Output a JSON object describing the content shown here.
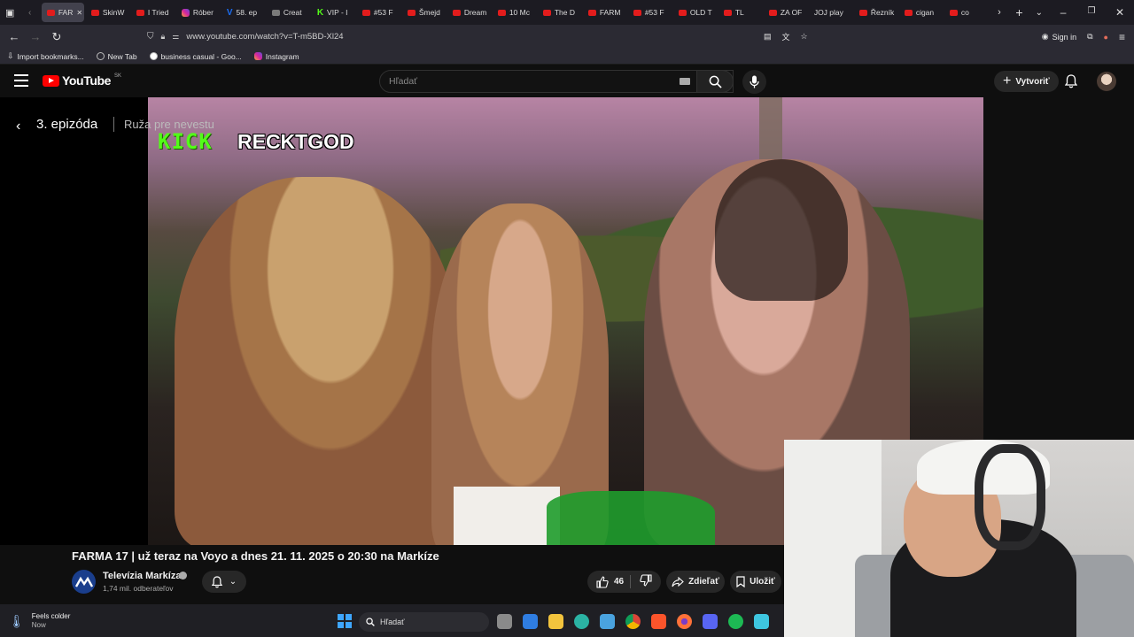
{
  "browser": {
    "tabs": [
      {
        "label": "FAR",
        "icon": "youtube-icon",
        "active": true
      },
      {
        "label": "SkinW",
        "icon": "skinwallet-icon"
      },
      {
        "label": "I Tried",
        "icon": "youtube-icon"
      },
      {
        "label": "Róber",
        "icon": "instagram-icon"
      },
      {
        "label": "58. ep",
        "icon": "v-icon"
      },
      {
        "label": "Creat",
        "icon": "create-icon"
      },
      {
        "label": "VIP - I",
        "icon": "kick-icon"
      },
      {
        "label": "#53 F",
        "icon": "youtube-icon"
      },
      {
        "label": "Šmejd",
        "icon": "youtube-icon"
      },
      {
        "label": "Dream",
        "icon": "youtube-icon"
      },
      {
        "label": "10 Mc",
        "icon": "youtube-icon"
      },
      {
        "label": "The D",
        "icon": "youtube-icon"
      },
      {
        "label": "FARM",
        "icon": "youtube-icon"
      },
      {
        "label": "#53 F",
        "icon": "youtube-icon"
      },
      {
        "label": "OLD T",
        "icon": "youtube-icon"
      },
      {
        "label": "TL",
        "icon": "youtube-icon"
      },
      {
        "label": "ZA OF",
        "icon": "youtube-icon"
      },
      {
        "label": "JOJ play",
        "icon": "joj-icon"
      },
      {
        "label": "Řezník",
        "icon": "youtube-icon"
      },
      {
        "label": "cigan",
        "icon": "youtube-icon"
      },
      {
        "label": "co",
        "icon": "youtube-icon"
      }
    ],
    "url": "www.youtube.com/watch?v=T-m5BD-Xl24",
    "sign_in": "Sign in",
    "bookmarks": [
      {
        "label": "Import bookmarks...",
        "icon": "import-icon"
      },
      {
        "label": "New Tab",
        "icon": "globe-icon"
      },
      {
        "label": "business casual - Goo...",
        "icon": "google-icon"
      },
      {
        "label": "Instagram",
        "icon": "instagram-icon"
      }
    ]
  },
  "youtube": {
    "logo_text": "YouTube",
    "region": "SK",
    "search_placeholder": "Hľadať",
    "create_label": "Vytvoriť"
  },
  "player": {
    "episode_title": "3. epizóda",
    "episode_subtitle": "Ruža pre nevestu",
    "overlay_brand": "KICK",
    "overlay_name": "RECKTGOD"
  },
  "video": {
    "title": "FARMA 17 | už teraz na Voyo a dnes 21. 11. 2025 o 20:30 na Markíze",
    "channel_name": "Televízia Markíza",
    "subscribers": "1,74 mil. odberateľov",
    "likes": "46",
    "share_label": "Zdieľať",
    "save_label": "Uložiť"
  },
  "taskbar": {
    "weather_line1": "Feels colder",
    "weather_line2": "Now",
    "search_label": "Hľadať"
  },
  "colors": {
    "youtube_red": "#ff0000",
    "kick_green": "#53fc18",
    "background": "#0f0f0f"
  }
}
